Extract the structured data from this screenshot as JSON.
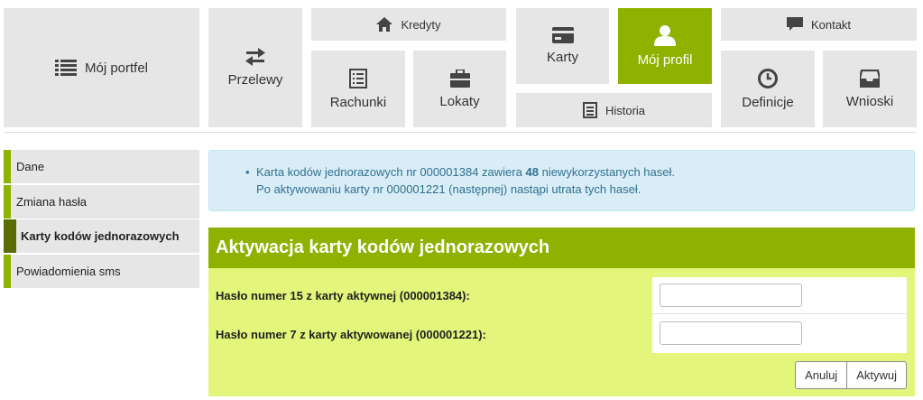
{
  "nav": {
    "moj_portfel": "Mój portfel",
    "przelewy": "Przelewy",
    "kredyty": "Kredyty",
    "rachunki": "Rachunki",
    "lokaty": "Lokaty",
    "karty": "Karty",
    "historia": "Historia",
    "moj_profil": "Mój profil",
    "kontakt": "Kontakt",
    "definicje": "Definicje",
    "wnioski": "Wnioski"
  },
  "sidebar": {
    "items": [
      {
        "label": "Dane"
      },
      {
        "label": "Zmiana hasła"
      },
      {
        "label": "Karty kodów jednorazowych"
      },
      {
        "label": "Powiadomienia sms"
      }
    ]
  },
  "info": {
    "line1_prefix": "Karta kodów jednorazowych nr 000001384 zawiera",
    "line1_count": "48",
    "line1_suffix": "niewykorzystanych haseł.",
    "line2": "Po aktywowaniu karty nr 000001221 (następnej) nastąpi utrata tych haseł."
  },
  "panel": {
    "title": "Aktywacja karty kodów jednorazowych",
    "field1_label": "Hasło numer 15 z karty aktywnej (000001384):",
    "field1_value": "",
    "field2_label": "Hasło numer 7 z karty aktywowanej (000001221):",
    "field2_value": "",
    "cancel_label": "Anuluj",
    "activate_label": "Aktywuj"
  },
  "colors": {
    "accent": "#8fb200",
    "accent_dark": "#5a6e00",
    "panel_bg": "#e3f57a",
    "info_bg": "#d9edf7",
    "tile_bg": "#e6e6e6"
  }
}
